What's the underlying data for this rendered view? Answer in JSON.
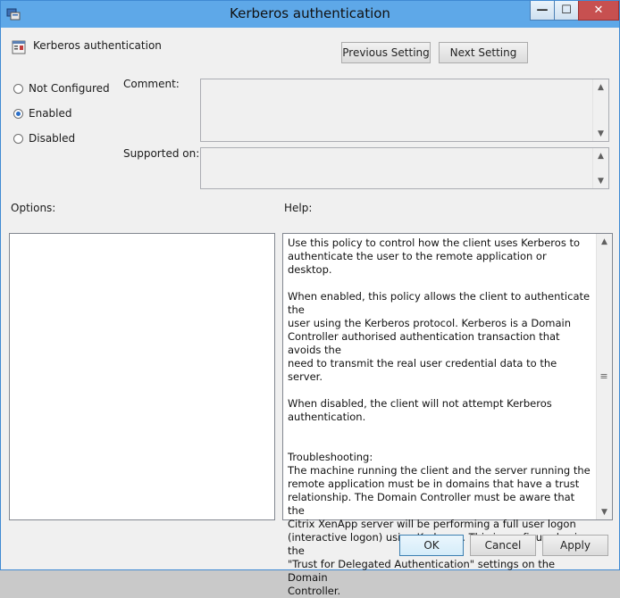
{
  "window": {
    "title": "Kerberos authentication",
    "controls": {
      "minimize": "—",
      "maximize": "☐",
      "close": "✕"
    }
  },
  "policy": {
    "name": "Kerberos authentication"
  },
  "nav": {
    "previous_label": "Previous Setting",
    "next_label": "Next Setting"
  },
  "state": {
    "options": [
      {
        "label": "Not Configured",
        "selected": false
      },
      {
        "label": "Enabled",
        "selected": true
      },
      {
        "label": "Disabled",
        "selected": false
      }
    ]
  },
  "fields": {
    "comment_label": "Comment:",
    "comment_value": "",
    "supported_label": "Supported on:",
    "supported_value": ""
  },
  "panels": {
    "options_label": "Options:",
    "help_label": "Help:"
  },
  "help": {
    "paragraphs": [
      "Use this policy to control how the client uses Kerberos to\nauthenticate the user to the remote application or desktop.",
      "When enabled, this policy allows the client to authenticate the\nuser using the Kerberos protocol.  Kerberos is a Domain\nController authorised authentication transaction that avoids the\nneed to transmit the real user credential data to the server.",
      "When disabled, the client will not attempt Kerberos\nauthentication.",
      "Troubleshooting:\nThe machine running the client and the server running the\nremote application must be in domains that have a trust\nrelationship.  The Domain Controller must be aware that the\nCitrix XenApp server will be performing a full user logon\n(interactive logon) using Kerberos.  This is configured using the\n\"Trust for Delegated Authentication\" settings on the Domain\nController."
    ]
  },
  "footer": {
    "ok_label": "OK",
    "cancel_label": "Cancel",
    "apply_label": "Apply"
  },
  "colors": {
    "titlebar": "#5ea8e8",
    "accent": "#2a6fc9",
    "close": "#c75050"
  }
}
